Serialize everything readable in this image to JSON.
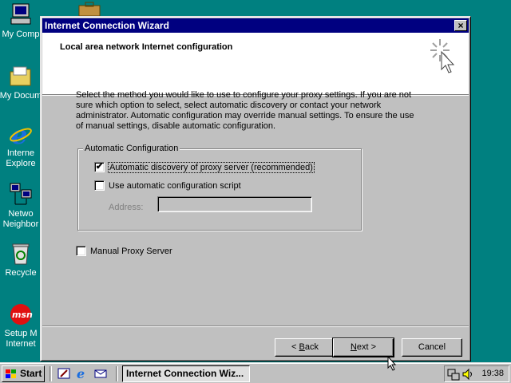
{
  "desktop": {
    "icons": [
      {
        "label": "My Comp",
        "icon": "computer-icon"
      },
      {
        "label": "My Docum",
        "icon": "folder-icon"
      },
      {
        "label": "Interne\nExplore",
        "icon": "internet-explorer-icon"
      },
      {
        "label": "Netwo\nNeighbor",
        "icon": "network-icon"
      },
      {
        "label": "Recycle",
        "icon": "recycle-bin-icon"
      },
      {
        "label": "Setup M\nInternet",
        "icon": "msn-icon"
      }
    ]
  },
  "window": {
    "title": "Internet Connection Wizard",
    "close_label": "×",
    "header_title": "Local area network Internet configuration",
    "intro_text": "Select the method you would like to use to configure your proxy settings.  If you are not sure which option to select, select automatic discovery or contact your network administrator.  Automatic configuration may override manual settings.  To ensure the use of manual settings, disable automatic configuration.",
    "group_label": "Automatic Configuration",
    "auto_discovery": {
      "label": "Automatic discovery of proxy server (recommended)",
      "checked": true,
      "mark": "✔"
    },
    "auto_script": {
      "label": "Use automatic configuration script",
      "underline": "s",
      "checked": false
    },
    "address_label": "Address:",
    "address_value": "",
    "manual_proxy": {
      "label": "Manual Proxy Server",
      "checked": false
    },
    "buttons": {
      "back": {
        "prefix": "< ",
        "u": "B",
        "rest": "ack"
      },
      "next": {
        "prefix": "",
        "u": "N",
        "rest": "ext >"
      },
      "cancel": "Cancel"
    }
  },
  "taskbar": {
    "start_label": "Start",
    "task_label": "Internet Connection Wiz...",
    "clock": "19:38"
  },
  "colors": {
    "desktop": "#008080",
    "titlebar": "#000080",
    "face": "#c0c0c0"
  }
}
